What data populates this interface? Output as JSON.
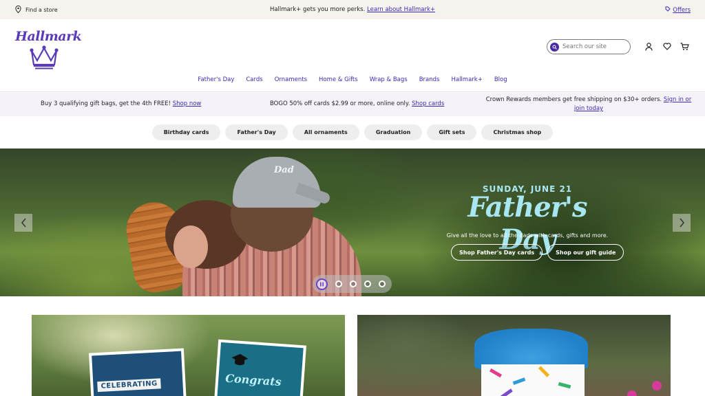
{
  "utility": {
    "store_label": "Find a store",
    "promo_text": "Hallmark+ gets you more perks.",
    "promo_link": "Learn about Hallmark+",
    "offers_label": "Offers"
  },
  "header": {
    "logo_text": "Hallmark",
    "search_placeholder": "Search our site"
  },
  "nav": [
    "Father's Day",
    "Cards",
    "Ornaments",
    "Home & Gifts",
    "Wrap & Bags",
    "Brands",
    "Hallmark+",
    "Blog"
  ],
  "promos": {
    "p1_text": "Buy 3 qualifying gift bags, get the 4th FREE!",
    "p1_link": "Shop now",
    "p2_text": "BOGO 50% off cards $2.99 or more, online only.",
    "p2_link": "Shop cards",
    "p3_text": "Crown Rewards members get free shipping on $30+ orders.",
    "p3_link": "Sign in or join today"
  },
  "chips": [
    "Birthday cards",
    "Father's Day",
    "All ornaments",
    "Graduation",
    "Gift sets",
    "Christmas shop"
  ],
  "hero": {
    "cap_text": "Dad",
    "kicker": "SUNDAY, JUNE 21",
    "headline": "Father's Day",
    "subline": "Give all the love to all the dads with cards, gifts and more.",
    "cta1": "Shop Father's Day cards",
    "cta2": "Shop our gift guide"
  },
  "cards": {
    "card1_ribbon": "CELEBRATING",
    "card2_script": "Congrats"
  },
  "colors": {
    "brand_purple": "#5a3ab8",
    "link_purple": "#3a2bb5",
    "hero_accent": "#a8e6f2"
  }
}
